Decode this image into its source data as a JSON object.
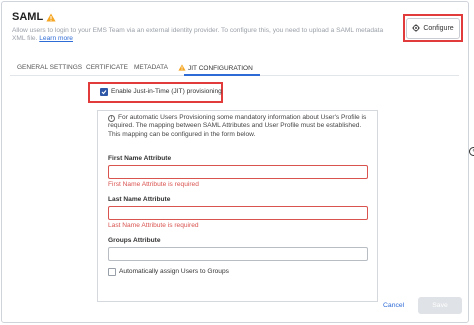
{
  "header": {
    "title": "SAML",
    "description": "Allow users to login to your EMS Team via an external identity provider. To configure this, you need to upload a SAML metadata XML file.",
    "learn_more": "Learn more",
    "configure_label": "Configure"
  },
  "tabs": [
    {
      "label": "GENERAL SETTINGS"
    },
    {
      "label": "CERTIFICATE"
    },
    {
      "label": "METADATA"
    },
    {
      "label": "JIT CONFIGURATION",
      "active": true
    }
  ],
  "jit": {
    "enable_label": "Enable Just-in-Time (JIT) provisioning",
    "enable_checked": true,
    "info_text": "For automatic Users Provisioning some mandatory information about User's Profile is required. The mapping between SAML Attributes and User Profile must be established. This mapping can be configured in the form below.",
    "first_name": {
      "label": "First Name Attribute",
      "value": "",
      "error": "First Name Attribute is required"
    },
    "last_name": {
      "label": "Last Name Attribute",
      "value": "",
      "error": "Last Name Attribute is required"
    },
    "groups": {
      "label": "Groups Attribute",
      "value": ""
    },
    "auto_assign_label": "Automatically assign Users to Groups",
    "auto_assign_checked": false
  },
  "footer": {
    "cancel_label": "Cancel",
    "save_label": "Save"
  },
  "colors": {
    "accent": "#2e6bd6",
    "error": "#d9534f",
    "highlight": "#e23b3b",
    "warning": "#f5a623"
  }
}
